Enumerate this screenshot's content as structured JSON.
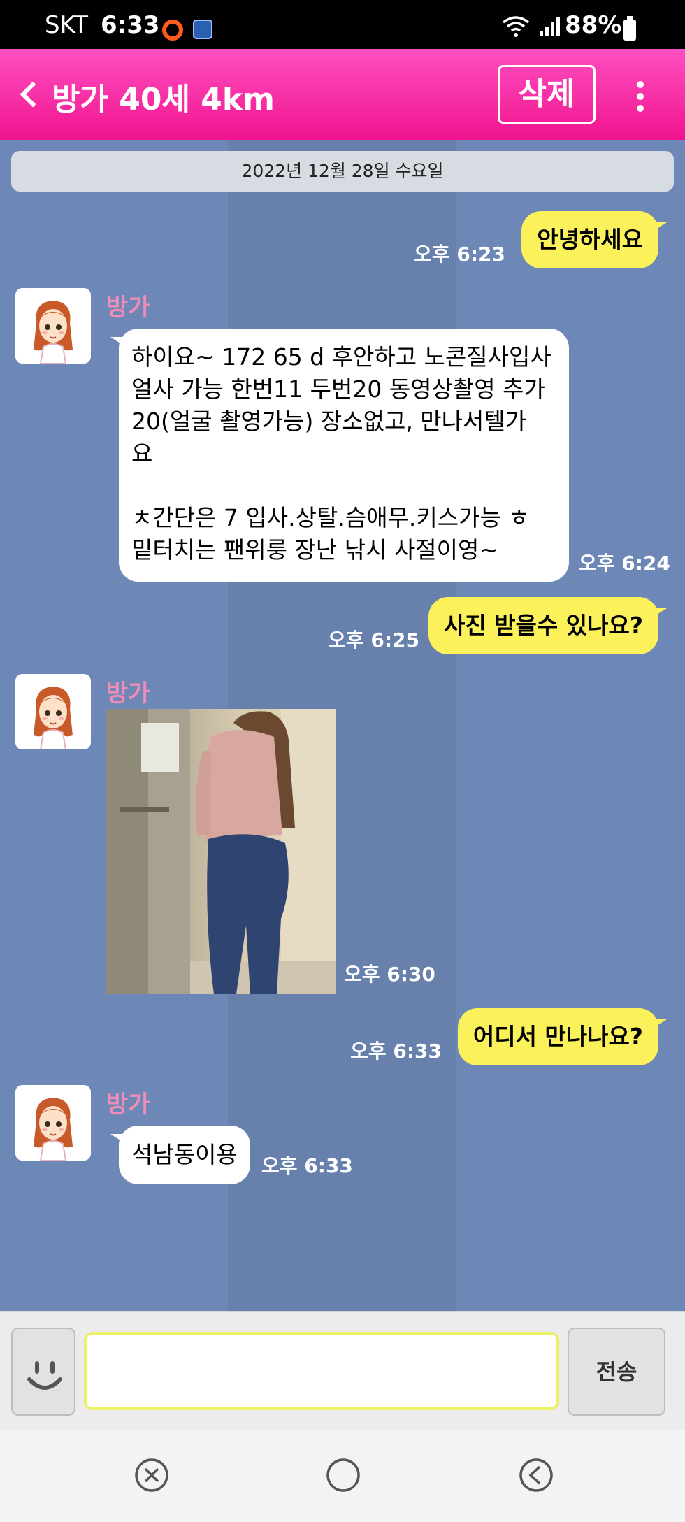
{
  "status_bar": {
    "carrier": "SKT",
    "time": "6:33",
    "battery": "88%"
  },
  "header": {
    "title": "방가 40세 4km",
    "delete_label": "삭제"
  },
  "chat": {
    "date": "2022년 12월 28일 수요일",
    "messages": [
      {
        "from": "me",
        "text": "안녕하세요",
        "time": "오후 6:23"
      },
      {
        "from": "them",
        "sender": "방가",
        "lines": [
          "하이요~ 172 65 d 후안하고 노콘질사입사",
          "얼사 가능 한번11 두번20 동영상촬영 추가",
          "20(얼굴 촬영가능) 장소없고, 만나서텔가",
          "요",
          "",
          "ㅊ간단은 7 입사.상탈.슴애무.키스가능 ㅎ",
          "밑터치는 팬위룽 장난 낚시 사절이영~"
        ],
        "time": "오후 6:24"
      },
      {
        "from": "me",
        "text": "사진 받을수 있나요?",
        "time": "오후 6:25"
      },
      {
        "from": "them",
        "sender": "방가",
        "type": "image",
        "time": "오후 6:30"
      },
      {
        "from": "me",
        "text": "어디서 만나나요?",
        "time": "오후 6:33"
      },
      {
        "from": "them",
        "sender": "방가",
        "text": "석남동이용",
        "time": "오후 6:33"
      }
    ]
  },
  "input": {
    "placeholder": "",
    "send_label": "전송"
  },
  "icons": {
    "back": "chevron-left-icon",
    "more": "more-vertical-icon",
    "emoji": "smiley-icon",
    "nav": [
      "recent-apps-icon",
      "home-icon",
      "back-icon"
    ]
  },
  "colors": {
    "header": "#f0148f",
    "chat_bg": "#6d88b6",
    "my_bubble": "#fbf15a",
    "sender_name": "#f08cb8"
  }
}
